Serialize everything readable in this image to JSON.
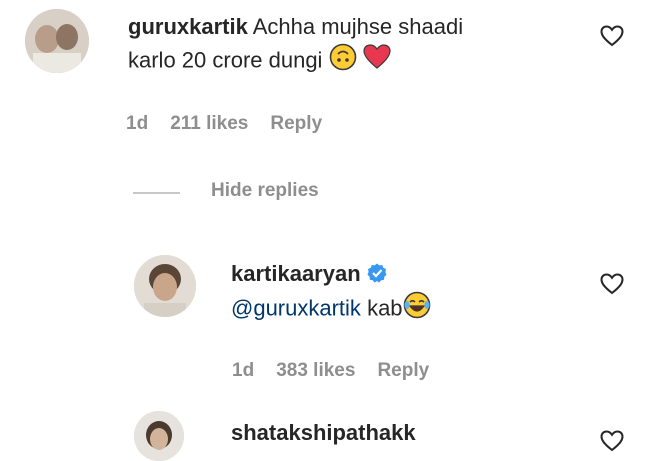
{
  "comment1": {
    "username": "guruxkartik",
    "text_line1": "Achha mujhse shaadi",
    "text_line2": "karlo 20 crore dungi",
    "emojis": [
      "upside-down-face-emoji",
      "red-heart-emoji"
    ],
    "time": "1d",
    "likes": "211 likes",
    "reply_label": "Reply",
    "hide_replies_label": "Hide replies"
  },
  "reply1": {
    "username": "kartikaaryan",
    "verified": true,
    "mention": "@guruxkartik",
    "text": "kab",
    "emoji": "tears-of-joy-emoji",
    "time": "1d",
    "likes": "383 likes",
    "reply_label": "Reply"
  },
  "comment2": {
    "username": "shatakshipathakk"
  },
  "colors": {
    "text": "#262626",
    "meta": "#8e8e8e",
    "mention": "#00376b",
    "verified": "#3897f0",
    "heart": "#ed4956"
  }
}
